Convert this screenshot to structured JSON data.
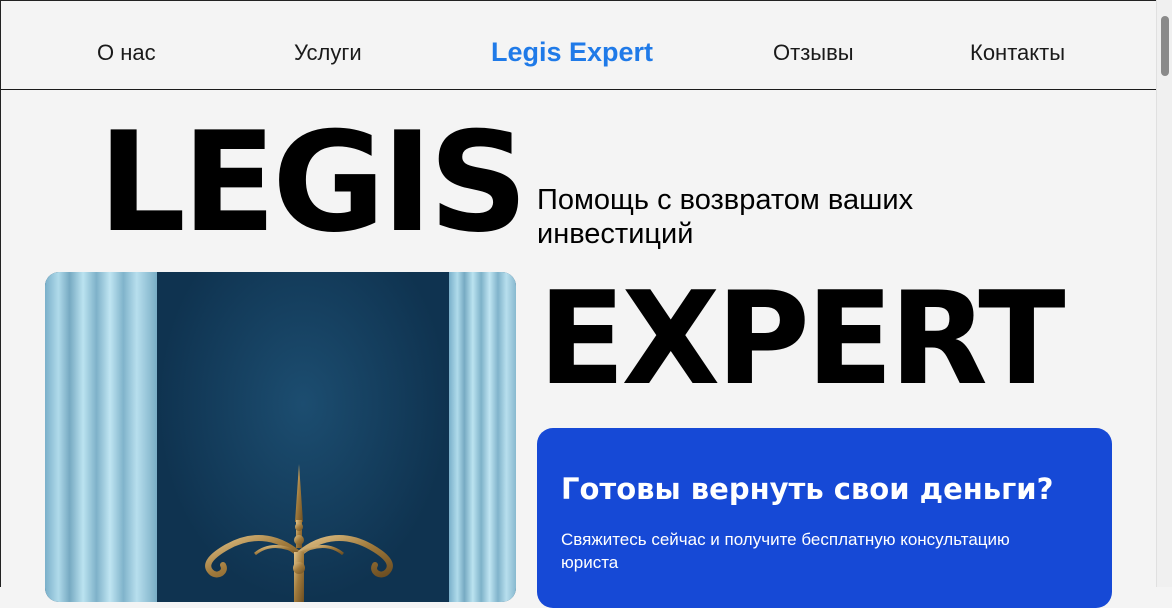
{
  "nav": {
    "about": "О нас",
    "services": "Услуги",
    "brand": "Legis Expert",
    "reviews": "Отзывы",
    "contacts": "Контакты"
  },
  "hero": {
    "word_top": "LEGIS",
    "subtitle": "Помощь с возвратом ваших инвестиций",
    "word_bottom": "EXPERT"
  },
  "cta": {
    "title": "Готовы вернуть свои деньги?",
    "text": "Свяжитесь сейчас и получите бесплатную консультацию юриста"
  },
  "colors": {
    "accent": "#1f7ae8",
    "card": "#1649d6",
    "background": "#f4f4f4"
  },
  "icons": {
    "hero_image": "scales-of-justice-with-columns"
  }
}
